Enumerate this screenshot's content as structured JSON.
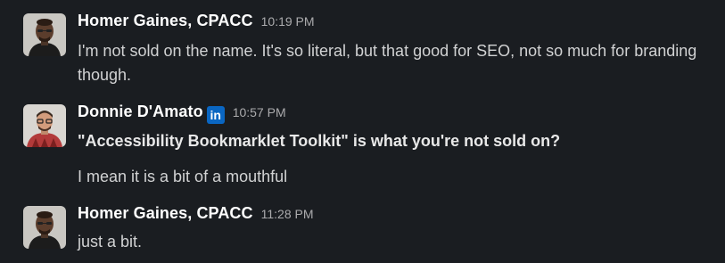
{
  "messages": [
    {
      "author": "Homer Gaines, CPACC",
      "time": "10:19 PM",
      "lines": [
        "I'm not sold on the name. It's so literal, but that good for SEO, not so much for branding though."
      ]
    },
    {
      "author": "Donnie D'Amato",
      "badge": "in",
      "time": "10:57 PM",
      "lines": [
        "\"Accessibility Bookmarklet Toolkit\" is what you're not sold on?",
        "I mean it is a bit of a mouthful"
      ]
    },
    {
      "author": "Homer Gaines, CPACC",
      "time": "11:28 PM",
      "lines": [
        "just a bit."
      ]
    }
  ],
  "colors": {
    "background": "#1a1d21",
    "author": "#ffffff",
    "text": "#d1d2d3",
    "timestamp": "#ababad",
    "linkedin": "#0a66c2"
  },
  "icons": {
    "badge": "linkedin-icon"
  }
}
